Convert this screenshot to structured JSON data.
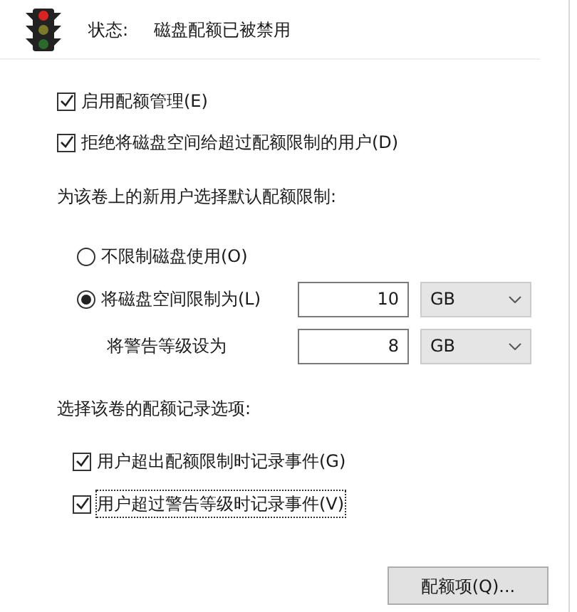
{
  "status": {
    "label": "状态:",
    "value": "磁盘配额已被禁用"
  },
  "options": [
    {
      "label": "启用配额管理(E)",
      "checked": true
    },
    {
      "label": "拒绝将磁盘空间给超过配额限制的用户(D)",
      "checked": true
    }
  ],
  "limit_section": {
    "title": "为该卷上的新用户选择默认配额限制:",
    "radios": [
      {
        "label": "不限制磁盘使用(O)",
        "selected": false
      },
      {
        "label": "将磁盘空间限制为(L)",
        "selected": true
      }
    ],
    "limit": {
      "value": "10",
      "unit": "GB"
    },
    "warning": {
      "label": "将警告等级设为",
      "value": "8",
      "unit": "GB"
    }
  },
  "logging_section": {
    "title": "选择该卷的配额记录选项:",
    "options": [
      {
        "label": "用户超出配额限制时记录事件(G)",
        "checked": true,
        "focused": false
      },
      {
        "label": "用户超过警告等级时记录事件(V)",
        "checked": true,
        "focused": true
      }
    ]
  },
  "button": "配额项(Q)..."
}
